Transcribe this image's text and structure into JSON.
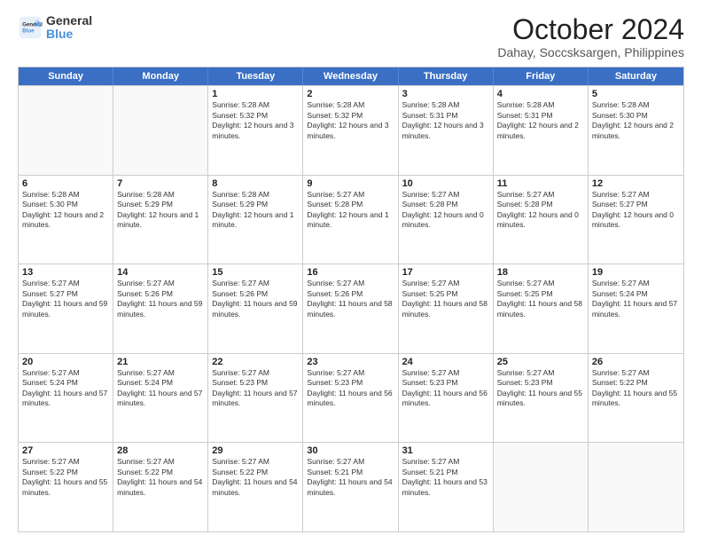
{
  "logo": {
    "line1": "General",
    "line2": "Blue"
  },
  "title": "October 2024",
  "location": "Dahay, Soccsksargen, Philippines",
  "weekdays": [
    "Sunday",
    "Monday",
    "Tuesday",
    "Wednesday",
    "Thursday",
    "Friday",
    "Saturday"
  ],
  "weeks": [
    [
      {
        "day": "",
        "text": ""
      },
      {
        "day": "",
        "text": ""
      },
      {
        "day": "1",
        "text": "Sunrise: 5:28 AM\nSunset: 5:32 PM\nDaylight: 12 hours and 3 minutes."
      },
      {
        "day": "2",
        "text": "Sunrise: 5:28 AM\nSunset: 5:32 PM\nDaylight: 12 hours and 3 minutes."
      },
      {
        "day": "3",
        "text": "Sunrise: 5:28 AM\nSunset: 5:31 PM\nDaylight: 12 hours and 3 minutes."
      },
      {
        "day": "4",
        "text": "Sunrise: 5:28 AM\nSunset: 5:31 PM\nDaylight: 12 hours and 2 minutes."
      },
      {
        "day": "5",
        "text": "Sunrise: 5:28 AM\nSunset: 5:30 PM\nDaylight: 12 hours and 2 minutes."
      }
    ],
    [
      {
        "day": "6",
        "text": "Sunrise: 5:28 AM\nSunset: 5:30 PM\nDaylight: 12 hours and 2 minutes."
      },
      {
        "day": "7",
        "text": "Sunrise: 5:28 AM\nSunset: 5:29 PM\nDaylight: 12 hours and 1 minute."
      },
      {
        "day": "8",
        "text": "Sunrise: 5:28 AM\nSunset: 5:29 PM\nDaylight: 12 hours and 1 minute."
      },
      {
        "day": "9",
        "text": "Sunrise: 5:27 AM\nSunset: 5:28 PM\nDaylight: 12 hours and 1 minute."
      },
      {
        "day": "10",
        "text": "Sunrise: 5:27 AM\nSunset: 5:28 PM\nDaylight: 12 hours and 0 minutes."
      },
      {
        "day": "11",
        "text": "Sunrise: 5:27 AM\nSunset: 5:28 PM\nDaylight: 12 hours and 0 minutes."
      },
      {
        "day": "12",
        "text": "Sunrise: 5:27 AM\nSunset: 5:27 PM\nDaylight: 12 hours and 0 minutes."
      }
    ],
    [
      {
        "day": "13",
        "text": "Sunrise: 5:27 AM\nSunset: 5:27 PM\nDaylight: 11 hours and 59 minutes."
      },
      {
        "day": "14",
        "text": "Sunrise: 5:27 AM\nSunset: 5:26 PM\nDaylight: 11 hours and 59 minutes."
      },
      {
        "day": "15",
        "text": "Sunrise: 5:27 AM\nSunset: 5:26 PM\nDaylight: 11 hours and 59 minutes."
      },
      {
        "day": "16",
        "text": "Sunrise: 5:27 AM\nSunset: 5:26 PM\nDaylight: 11 hours and 58 minutes."
      },
      {
        "day": "17",
        "text": "Sunrise: 5:27 AM\nSunset: 5:25 PM\nDaylight: 11 hours and 58 minutes."
      },
      {
        "day": "18",
        "text": "Sunrise: 5:27 AM\nSunset: 5:25 PM\nDaylight: 11 hours and 58 minutes."
      },
      {
        "day": "19",
        "text": "Sunrise: 5:27 AM\nSunset: 5:24 PM\nDaylight: 11 hours and 57 minutes."
      }
    ],
    [
      {
        "day": "20",
        "text": "Sunrise: 5:27 AM\nSunset: 5:24 PM\nDaylight: 11 hours and 57 minutes."
      },
      {
        "day": "21",
        "text": "Sunrise: 5:27 AM\nSunset: 5:24 PM\nDaylight: 11 hours and 57 minutes."
      },
      {
        "day": "22",
        "text": "Sunrise: 5:27 AM\nSunset: 5:23 PM\nDaylight: 11 hours and 57 minutes."
      },
      {
        "day": "23",
        "text": "Sunrise: 5:27 AM\nSunset: 5:23 PM\nDaylight: 11 hours and 56 minutes."
      },
      {
        "day": "24",
        "text": "Sunrise: 5:27 AM\nSunset: 5:23 PM\nDaylight: 11 hours and 56 minutes."
      },
      {
        "day": "25",
        "text": "Sunrise: 5:27 AM\nSunset: 5:23 PM\nDaylight: 11 hours and 55 minutes."
      },
      {
        "day": "26",
        "text": "Sunrise: 5:27 AM\nSunset: 5:22 PM\nDaylight: 11 hours and 55 minutes."
      }
    ],
    [
      {
        "day": "27",
        "text": "Sunrise: 5:27 AM\nSunset: 5:22 PM\nDaylight: 11 hours and 55 minutes."
      },
      {
        "day": "28",
        "text": "Sunrise: 5:27 AM\nSunset: 5:22 PM\nDaylight: 11 hours and 54 minutes."
      },
      {
        "day": "29",
        "text": "Sunrise: 5:27 AM\nSunset: 5:22 PM\nDaylight: 11 hours and 54 minutes."
      },
      {
        "day": "30",
        "text": "Sunrise: 5:27 AM\nSunset: 5:21 PM\nDaylight: 11 hours and 54 minutes."
      },
      {
        "day": "31",
        "text": "Sunrise: 5:27 AM\nSunset: 5:21 PM\nDaylight: 11 hours and 53 minutes."
      },
      {
        "day": "",
        "text": ""
      },
      {
        "day": "",
        "text": ""
      }
    ]
  ]
}
